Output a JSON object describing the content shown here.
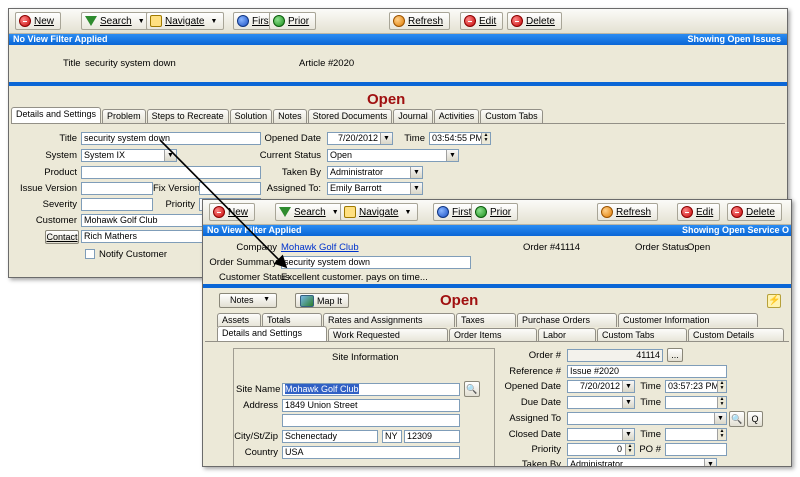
{
  "toolbar": {
    "new": "New",
    "search": "Search",
    "navigate": "Navigate",
    "first": "First",
    "prior": "Prior",
    "refresh": "Refresh",
    "edit": "Edit",
    "delete": "Delete"
  },
  "win1": {
    "filter_text": "No View Filter Applied",
    "showing_text": "Showing Open Issues",
    "title_label": "Title",
    "title_value": "security system down",
    "article_label": "Article #",
    "article_value": "2020",
    "status_heading": "Open",
    "tabs": [
      "Details and Settings",
      "Problem",
      "Steps to Recreate",
      "Solution",
      "Notes",
      "Stored Documents",
      "Journal",
      "Activities",
      "Custom Tabs"
    ],
    "fields": {
      "title_label": "Title",
      "title_value": "security system down",
      "system_label": "System",
      "system_value": "System IX",
      "product_label": "Product",
      "product_value": "",
      "issue_version_label": "Issue Version",
      "fix_version_label": "Fix Version",
      "severity_label": "Severity",
      "priority_label": "Priority",
      "customer_label": "Customer",
      "customer_value": "Mohawk Golf Club",
      "contact_button": "Contact",
      "contact_value": "Rich Mathers",
      "notify_label": "Notify Customer",
      "opened_date_label": "Opened Date",
      "opened_date_value": "7/20/2012",
      "time_label": "Time",
      "time_value": "03:54:55 PM",
      "current_status_label": "Current Status",
      "current_status_value": "Open",
      "taken_by_label": "Taken By",
      "taken_by_value": "Administrator",
      "assigned_to_label": "Assigned To:",
      "assigned_to_value": "Emily Barrott"
    }
  },
  "win2": {
    "filter_text": "No View Filter Applied",
    "showing_text": "Showing Open Service O",
    "company_label": "Company",
    "company_value": "Mohawk Golf Club",
    "order_num_label": "Order #",
    "order_num_value": "41114",
    "order_status_label": "Order Status",
    "order_status_value": "Open",
    "order_summary_label": "Order Summary",
    "order_summary_value": "security system down",
    "customer_status_label": "Customer Status",
    "customer_status_value": "Excellent customer.  pays on time...",
    "notes_button": "Notes",
    "map_button": "Map It",
    "status_heading": "Open",
    "tabs_row1": [
      "Assets",
      "Totals",
      "Rates and Assignments",
      "Taxes",
      "Purchase Orders",
      "Customer Information"
    ],
    "tabs_row2": [
      "Details and Settings",
      "Work Requested",
      "Order Items",
      "Labor",
      "Custom Tabs",
      "Custom Details"
    ],
    "site_info_title": "Site Information",
    "site_name_label": "Site Name",
    "site_name_value": "Mohawk Golf Club",
    "address_label": "Address",
    "address_value": "1849 Union Street",
    "city_label": "City/St/Zip",
    "city_value": "Schenectady",
    "state_value": "NY",
    "zip_value": "12309",
    "country_label": "Country",
    "country_value": "USA",
    "order_label": "Order #",
    "order_value": "41114",
    "reference_label": "Reference #",
    "reference_value": "Issue #2020",
    "opened_date_label": "Opened Date",
    "opened_date_value": "7/20/2012",
    "time_label": "Time",
    "time_value": "03:57:23 PM",
    "due_date_label": "Due Date",
    "due_time_label": "Time",
    "assigned_to_label": "Assigned To",
    "q_button": "Q",
    "closed_date_label": "Closed Date",
    "closed_time_label": "Time",
    "priority_label": "Priority",
    "priority_value": "0",
    "po_label": "PO #",
    "taken_by_label": "Taken By",
    "taken_by_value": "Administrator"
  }
}
